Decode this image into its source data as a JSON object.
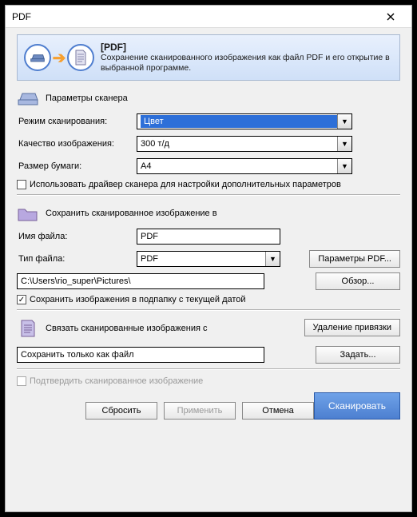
{
  "window": {
    "title": "PDF"
  },
  "banner": {
    "title": "[PDF]",
    "description": "Сохранение сканированного изображения как файл PDF и его открытие в выбранной программе."
  },
  "scanner": {
    "section_title": "Параметры сканера",
    "scan_mode_label": "Режим сканирования:",
    "scan_mode_value": "Цвет",
    "quality_label": "Качество изображения:",
    "quality_value": "300 т/д",
    "paper_label": "Размер бумаги:",
    "paper_value": "A4",
    "use_driver_label": "Использовать драйвер сканера для настройки дополнительных параметров"
  },
  "save": {
    "section_title": "Сохранить сканированное изображение в",
    "filename_label": "Имя файла:",
    "filename_value": "PDF",
    "filetype_label": "Тип файла:",
    "filetype_value": "PDF",
    "pdf_params_btn": "Параметры PDF...",
    "path_value": "C:\\Users\\rio_super\\Pictures\\",
    "browse_btn": "Обзор...",
    "subfolder_label": "Сохранить изображения в подпапку с текущей датой"
  },
  "link": {
    "section_title": "Связать сканированные изображения с",
    "remove_btn": "Удаление привязки",
    "save_only_value": "Сохранить только как файл",
    "set_btn": "Задать..."
  },
  "confirm": {
    "label": "Подтвердить сканированное изображение"
  },
  "buttons": {
    "reset": "Сбросить",
    "apply": "Применить",
    "cancel": "Отмена",
    "scan": "Сканировать"
  }
}
